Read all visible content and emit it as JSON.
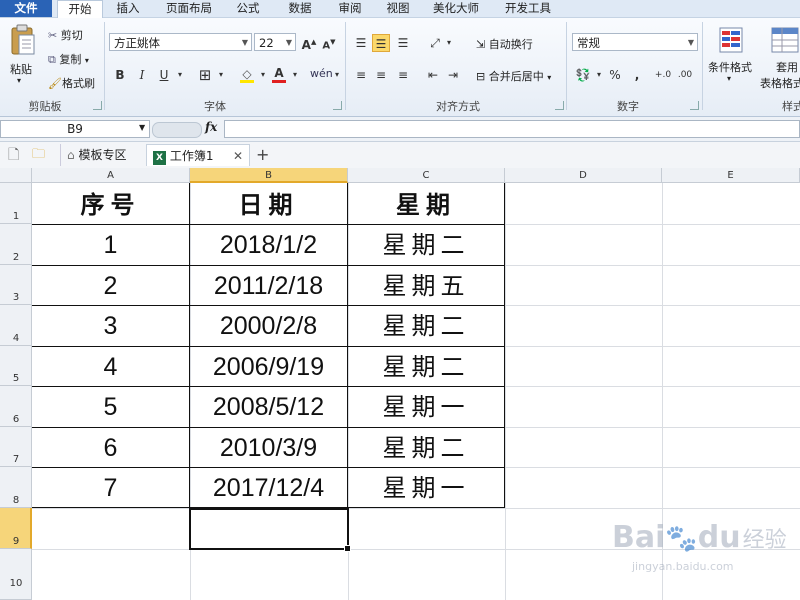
{
  "menu": {
    "tabs": [
      "文件",
      "开始",
      "插入",
      "页面布局",
      "公式",
      "数据",
      "审阅",
      "视图",
      "美化大师",
      "开发工具"
    ],
    "active": "开始"
  },
  "ribbon": {
    "clipboard": {
      "paste": "粘贴",
      "cut": "剪切",
      "copy": "复制",
      "format_painter": "格式刷",
      "label": "剪贴板"
    },
    "font": {
      "font_name": "方正姚体",
      "font_size": "22",
      "label": "字体"
    },
    "alignment": {
      "wrap_text": "自动换行",
      "merge_center": "合并后居中",
      "label": "对齐方式"
    },
    "number": {
      "format": "常规",
      "label": "数字"
    },
    "styles": {
      "conditional": "条件格式",
      "table_format": "套用\n表格格式",
      "label": "样式"
    }
  },
  "formula_bar": {
    "name_box": "B9",
    "fx": "fx",
    "content": ""
  },
  "doc_tabs": {
    "template": "模板专区",
    "workbook": "工作簿1",
    "add": "+"
  },
  "sheet": {
    "columns": [
      "A",
      "B",
      "C",
      "D",
      "E"
    ],
    "rows": [
      "1",
      "2",
      "3",
      "4",
      "5",
      "6",
      "7",
      "8",
      "9",
      "10"
    ],
    "selected_cell": "B9",
    "header": [
      "序号",
      "日期",
      "星期"
    ],
    "data": [
      [
        "1",
        "2018/1/2",
        "星期二"
      ],
      [
        "2",
        "2011/2/18",
        "星期五"
      ],
      [
        "3",
        "2000/2/8",
        "星期二"
      ],
      [
        "4",
        "2006/9/19",
        "星期二"
      ],
      [
        "5",
        "2008/5/12",
        "星期一"
      ],
      [
        "6",
        "2010/3/9",
        "星期二"
      ],
      [
        "7",
        "2017/12/4",
        "星期一"
      ]
    ]
  },
  "watermark": {
    "brand": "Bai",
    "brand2": "du",
    "text": "经验",
    "url": "jingyan.baidu.com"
  }
}
